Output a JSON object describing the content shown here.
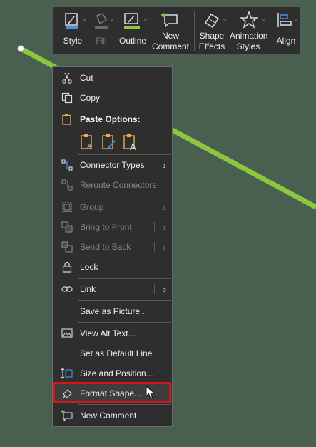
{
  "toolbar": {
    "style_label": "Style",
    "fill_label": "Fill",
    "outline_label": "Outline",
    "new_comment_label_1": "New",
    "new_comment_label_2": "Comment",
    "shape_effects_label_1": "Shape",
    "shape_effects_label_2": "Effects",
    "animation_styles_label_1": "Animation",
    "animation_styles_label_2": "Styles",
    "align_label": "Align"
  },
  "menu": {
    "cut": "Cut",
    "copy": "Copy",
    "paste_options": "Paste Options:",
    "connector_types": "Connector Types",
    "reroute_connectors": "Reroute Connectors",
    "group": "Group",
    "bring_to_front": "Bring to Front",
    "send_to_back": "Send to Back",
    "lock": "Lock",
    "link": "Link",
    "save_as_picture": "Save as Picture...",
    "view_alt_text": "View Alt Text...",
    "set_default_line": "Set as Default Line",
    "size_and_position": "Size and Position...",
    "format_shape": "Format Shape...",
    "new_comment": "New Comment"
  },
  "colors": {
    "background": "#495f50",
    "line": "#8dc63f",
    "menu_bg": "#2e2e2e",
    "highlight": "#d4161c",
    "paste_icon": "#e8b04a"
  }
}
